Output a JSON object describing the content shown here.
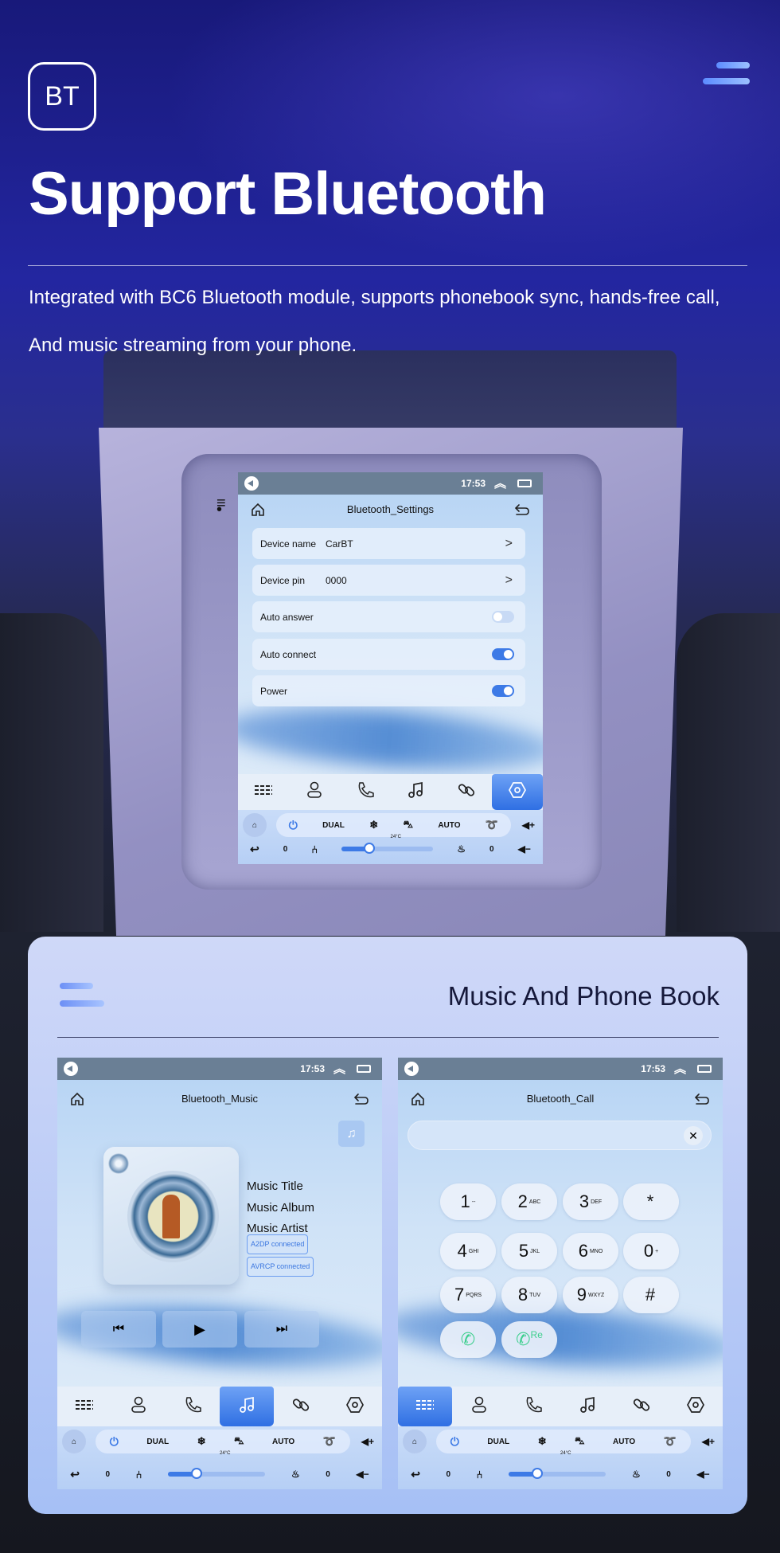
{
  "hero": {
    "badge": "BT",
    "title": "Support Bluetooth",
    "desc_line1": "Integrated with BC6 Bluetooth module, supports phonebook sync, hands-free call,",
    "desc_line2": "And music streaming from your phone."
  },
  "card": {
    "heading": "Music And Phone Book"
  },
  "status": {
    "time": "17:53"
  },
  "climate": {
    "dual": "DUAL",
    "auto": "AUTO",
    "temp": "24°C",
    "left_value": "0",
    "right_value": "0"
  },
  "settings": {
    "title": "Bluetooth_Settings",
    "device_name_label": "Device name",
    "device_name": "CarBT",
    "device_pin_label": "Device pin",
    "device_pin": "0000",
    "auto_answer_label": "Auto answer",
    "auto_answer": false,
    "auto_connect_label": "Auto connect",
    "auto_connect": true,
    "power_label": "Power",
    "power": true,
    "active_tab": "settings"
  },
  "music": {
    "title": "Bluetooth_Music",
    "track_title": "Music Title",
    "album": "Music Album",
    "artist": "Music Artist",
    "a2dp": "A2DP  connected",
    "avrcp": "AVRCP connected",
    "active_tab": "music"
  },
  "call": {
    "title": "Bluetooth_Call",
    "number_value": "",
    "keys": [
      {
        "d": "1",
        "l": "--"
      },
      {
        "d": "2",
        "l": "ABC"
      },
      {
        "d": "3",
        "l": "DEF"
      },
      {
        "d": "*",
        "l": ""
      },
      {
        "d": "4",
        "l": "GHI"
      },
      {
        "d": "5",
        "l": "JKL"
      },
      {
        "d": "6",
        "l": "MNO"
      },
      {
        "d": "0",
        "l": "+"
      },
      {
        "d": "7",
        "l": "PQRS"
      },
      {
        "d": "8",
        "l": "TUV"
      },
      {
        "d": "9",
        "l": "WXYZ"
      },
      {
        "d": "#",
        "l": ""
      }
    ],
    "redial_label": "Re",
    "active_tab": "keypad"
  },
  "nav_tabs": [
    "keypad",
    "contacts",
    "calls",
    "music",
    "link",
    "settings"
  ],
  "colors": {
    "accent": "#3d7ae6",
    "call_green": "#3ecf8e",
    "status_bar": "#6a7f95"
  }
}
